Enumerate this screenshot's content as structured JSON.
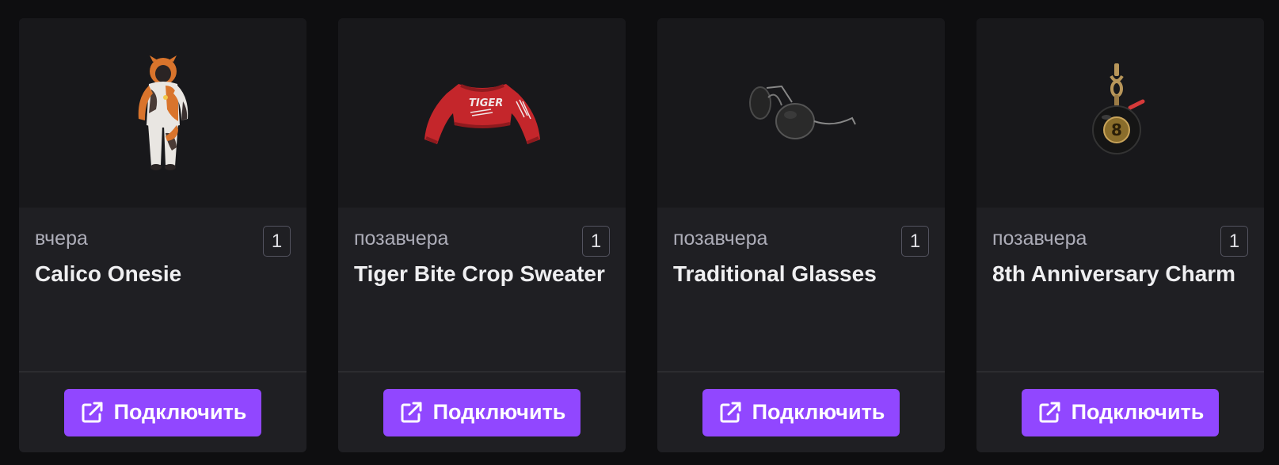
{
  "accent_color": "#9147ff",
  "cards": [
    {
      "date": "вчера",
      "quantity": "1",
      "title": "Calico Onesie",
      "image_icon": "calico-onesie-icon",
      "button_label": "Подключить",
      "button_icon": "external-link-icon"
    },
    {
      "date": "позавчера",
      "quantity": "1",
      "title": "Tiger Bite Crop Sweater",
      "image_icon": "crop-sweater-icon",
      "image_text": "TIGER",
      "button_label": "Подключить",
      "button_icon": "external-link-icon"
    },
    {
      "date": "позавчера",
      "quantity": "1",
      "title": "Traditional Glasses",
      "image_icon": "glasses-icon",
      "button_label": "Подключить",
      "button_icon": "external-link-icon"
    },
    {
      "date": "позавчера",
      "quantity": "1",
      "title": "8th Anniversary Charm",
      "image_icon": "eight-ball-charm-icon",
      "image_text": "8",
      "button_label": "Подключить",
      "button_icon": "external-link-icon"
    }
  ]
}
